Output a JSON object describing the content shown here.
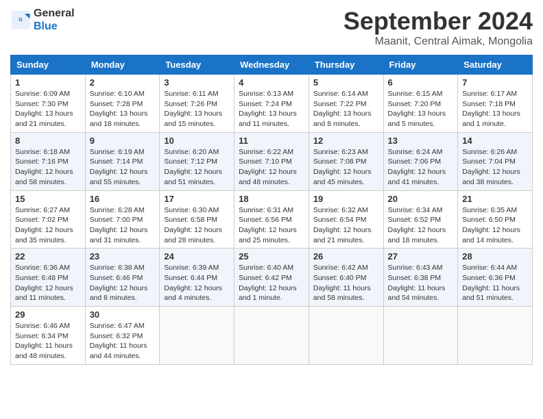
{
  "header": {
    "logo_line1": "General",
    "logo_line2": "Blue",
    "month": "September 2024",
    "location": "Maanit, Central Aimak, Mongolia"
  },
  "days_of_week": [
    "Sunday",
    "Monday",
    "Tuesday",
    "Wednesday",
    "Thursday",
    "Friday",
    "Saturday"
  ],
  "weeks": [
    [
      {
        "day": "1",
        "info": "Sunrise: 6:09 AM\nSunset: 7:30 PM\nDaylight: 13 hours\nand 21 minutes."
      },
      {
        "day": "2",
        "info": "Sunrise: 6:10 AM\nSunset: 7:28 PM\nDaylight: 13 hours\nand 18 minutes."
      },
      {
        "day": "3",
        "info": "Sunrise: 6:11 AM\nSunset: 7:26 PM\nDaylight: 13 hours\nand 15 minutes."
      },
      {
        "day": "4",
        "info": "Sunrise: 6:13 AM\nSunset: 7:24 PM\nDaylight: 13 hours\nand 11 minutes."
      },
      {
        "day": "5",
        "info": "Sunrise: 6:14 AM\nSunset: 7:22 PM\nDaylight: 13 hours\nand 8 minutes."
      },
      {
        "day": "6",
        "info": "Sunrise: 6:15 AM\nSunset: 7:20 PM\nDaylight: 13 hours\nand 5 minutes."
      },
      {
        "day": "7",
        "info": "Sunrise: 6:17 AM\nSunset: 7:18 PM\nDaylight: 13 hours\nand 1 minute."
      }
    ],
    [
      {
        "day": "8",
        "info": "Sunrise: 6:18 AM\nSunset: 7:16 PM\nDaylight: 12 hours\nand 58 minutes."
      },
      {
        "day": "9",
        "info": "Sunrise: 6:19 AM\nSunset: 7:14 PM\nDaylight: 12 hours\nand 55 minutes."
      },
      {
        "day": "10",
        "info": "Sunrise: 6:20 AM\nSunset: 7:12 PM\nDaylight: 12 hours\nand 51 minutes."
      },
      {
        "day": "11",
        "info": "Sunrise: 6:22 AM\nSunset: 7:10 PM\nDaylight: 12 hours\nand 48 minutes."
      },
      {
        "day": "12",
        "info": "Sunrise: 6:23 AM\nSunset: 7:08 PM\nDaylight: 12 hours\nand 45 minutes."
      },
      {
        "day": "13",
        "info": "Sunrise: 6:24 AM\nSunset: 7:06 PM\nDaylight: 12 hours\nand 41 minutes."
      },
      {
        "day": "14",
        "info": "Sunrise: 6:26 AM\nSunset: 7:04 PM\nDaylight: 12 hours\nand 38 minutes."
      }
    ],
    [
      {
        "day": "15",
        "info": "Sunrise: 6:27 AM\nSunset: 7:02 PM\nDaylight: 12 hours\nand 35 minutes."
      },
      {
        "day": "16",
        "info": "Sunrise: 6:28 AM\nSunset: 7:00 PM\nDaylight: 12 hours\nand 31 minutes."
      },
      {
        "day": "17",
        "info": "Sunrise: 6:30 AM\nSunset: 6:58 PM\nDaylight: 12 hours\nand 28 minutes."
      },
      {
        "day": "18",
        "info": "Sunrise: 6:31 AM\nSunset: 6:56 PM\nDaylight: 12 hours\nand 25 minutes."
      },
      {
        "day": "19",
        "info": "Sunrise: 6:32 AM\nSunset: 6:54 PM\nDaylight: 12 hours\nand 21 minutes."
      },
      {
        "day": "20",
        "info": "Sunrise: 6:34 AM\nSunset: 6:52 PM\nDaylight: 12 hours\nand 18 minutes."
      },
      {
        "day": "21",
        "info": "Sunrise: 6:35 AM\nSunset: 6:50 PM\nDaylight: 12 hours\nand 14 minutes."
      }
    ],
    [
      {
        "day": "22",
        "info": "Sunrise: 6:36 AM\nSunset: 6:48 PM\nDaylight: 12 hours\nand 11 minutes."
      },
      {
        "day": "23",
        "info": "Sunrise: 6:38 AM\nSunset: 6:46 PM\nDaylight: 12 hours\nand 8 minutes."
      },
      {
        "day": "24",
        "info": "Sunrise: 6:39 AM\nSunset: 6:44 PM\nDaylight: 12 hours\nand 4 minutes."
      },
      {
        "day": "25",
        "info": "Sunrise: 6:40 AM\nSunset: 6:42 PM\nDaylight: 12 hours\nand 1 minute."
      },
      {
        "day": "26",
        "info": "Sunrise: 6:42 AM\nSunset: 6:40 PM\nDaylight: 11 hours\nand 58 minutes."
      },
      {
        "day": "27",
        "info": "Sunrise: 6:43 AM\nSunset: 6:38 PM\nDaylight: 11 hours\nand 54 minutes."
      },
      {
        "day": "28",
        "info": "Sunrise: 6:44 AM\nSunset: 6:36 PM\nDaylight: 11 hours\nand 51 minutes."
      }
    ],
    [
      {
        "day": "29",
        "info": "Sunrise: 6:46 AM\nSunset: 6:34 PM\nDaylight: 11 hours\nand 48 minutes."
      },
      {
        "day": "30",
        "info": "Sunrise: 6:47 AM\nSunset: 6:32 PM\nDaylight: 11 hours\nand 44 minutes."
      },
      {
        "day": "",
        "info": ""
      },
      {
        "day": "",
        "info": ""
      },
      {
        "day": "",
        "info": ""
      },
      {
        "day": "",
        "info": ""
      },
      {
        "day": "",
        "info": ""
      }
    ]
  ]
}
